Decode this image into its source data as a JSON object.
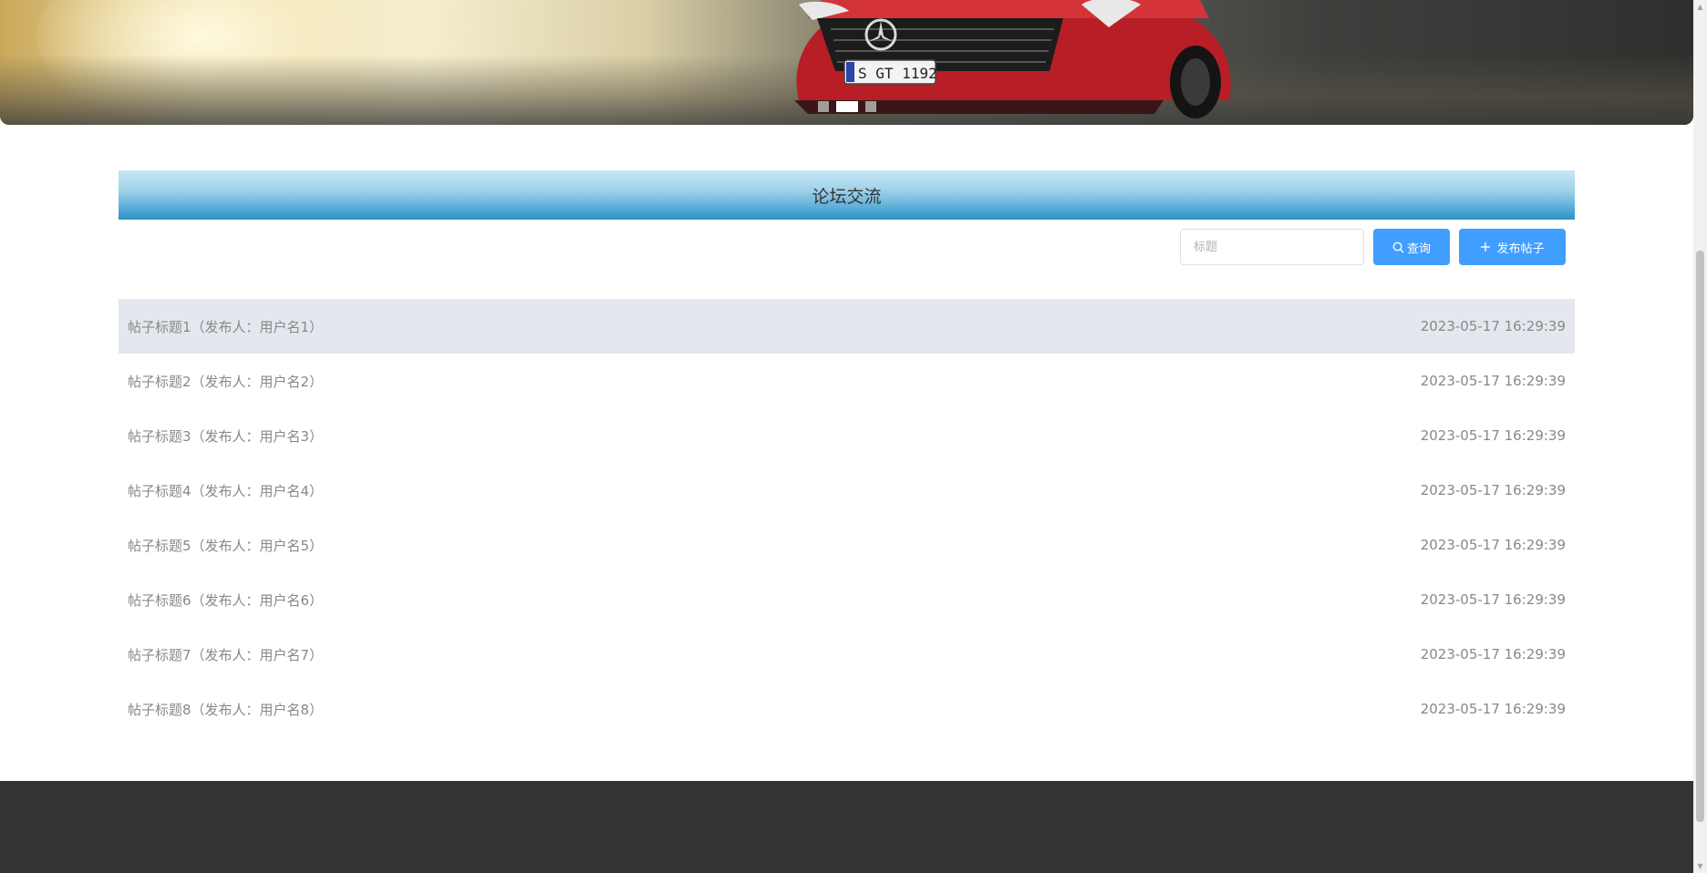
{
  "carousel": {
    "slide_count": 3,
    "active_index": 1,
    "plate_text": "S GT 1192"
  },
  "forum": {
    "title": "论坛交流",
    "search": {
      "placeholder": "标题",
      "value": ""
    },
    "search_button": "查询",
    "publish_button": "发布帖子",
    "posts": [
      {
        "title": "帖子标题1（发布人：用户名1）",
        "time": "2023-05-17 16:29:39"
      },
      {
        "title": "帖子标题2（发布人：用户名2）",
        "time": "2023-05-17 16:29:39"
      },
      {
        "title": "帖子标题3（发布人：用户名3）",
        "time": "2023-05-17 16:29:39"
      },
      {
        "title": "帖子标题4（发布人：用户名4）",
        "time": "2023-05-17 16:29:39"
      },
      {
        "title": "帖子标题5（发布人：用户名5）",
        "time": "2023-05-17 16:29:39"
      },
      {
        "title": "帖子标题6（发布人：用户名6）",
        "time": "2023-05-17 16:29:39"
      },
      {
        "title": "帖子标题7（发布人：用户名7）",
        "time": "2023-05-17 16:29:39"
      },
      {
        "title": "帖子标题8（发布人：用户名8）",
        "time": "2023-05-17 16:29:39"
      }
    ]
  },
  "colors": {
    "primary": "#409eff",
    "header_gradient_top": "#c8e6f4",
    "header_gradient_bottom": "#2f8ec6",
    "highlight_row": "#e4e7ee",
    "footer": "#333333",
    "car_red": "#c9252c"
  },
  "icons": {
    "search_button_icon": "search-icon",
    "publish_button_icon": "plus-icon",
    "car_logo": "mercedes-star-icon"
  }
}
